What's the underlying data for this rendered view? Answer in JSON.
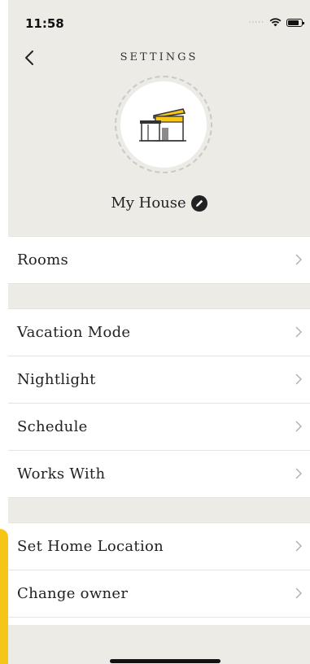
{
  "status": {
    "time": "11:58"
  },
  "header": {
    "title": "SETTINGS",
    "home_name": "My House"
  },
  "menu": {
    "group1": [
      {
        "label": "Rooms"
      }
    ],
    "group2": [
      {
        "label": "Vacation Mode"
      },
      {
        "label": "Nightlight"
      },
      {
        "label": "Schedule"
      },
      {
        "label": "Works With"
      }
    ],
    "group3": [
      {
        "label": "Set Home Location"
      },
      {
        "label": "Change owner"
      }
    ]
  },
  "colors": {
    "accent": "#f5c518",
    "header_bg": "#ecebe6"
  },
  "icons": {
    "back": "chevron-left-icon",
    "edit": "pencil-icon",
    "row": "chevron-right-icon",
    "house": "house-icon"
  }
}
